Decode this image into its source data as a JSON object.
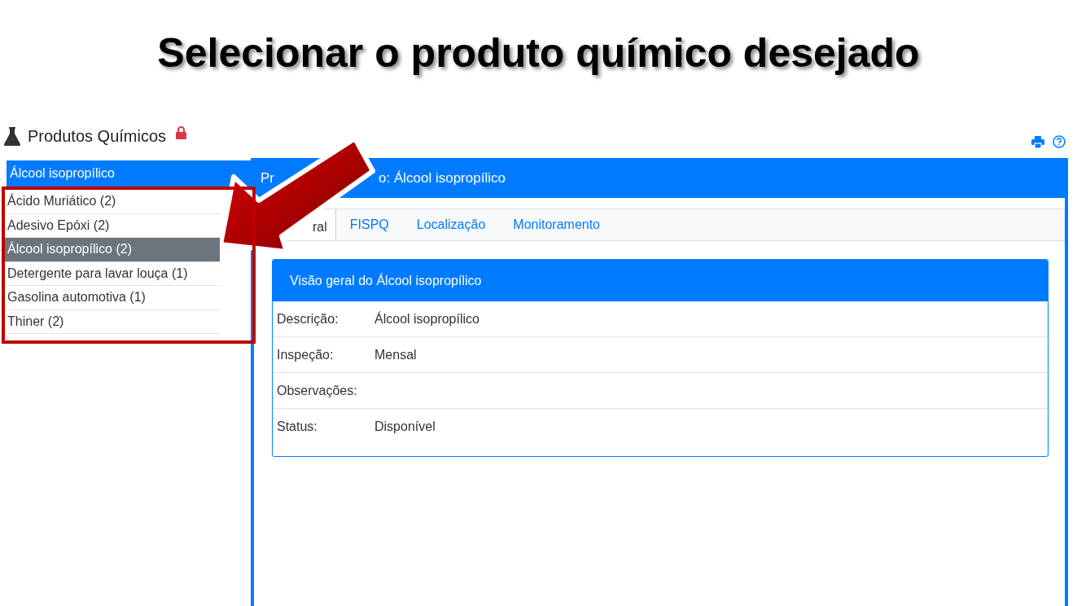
{
  "slide_title": "Selecionar o produto químico desejado",
  "page": {
    "title": "Produtos Químicos",
    "locked": true
  },
  "sidebar": {
    "header": "Álcool isopropílico",
    "items": [
      {
        "label": "Ácido Muriático (2)",
        "selected": false
      },
      {
        "label": "Adesivo Epóxi (2)",
        "selected": false
      },
      {
        "label": "Álcool isopropílico (2)",
        "selected": true
      },
      {
        "label": "Detergente para lavar louça (1)",
        "selected": false
      },
      {
        "label": "Gasolina automotiva (1)",
        "selected": false
      },
      {
        "label": "Thiner (2)",
        "selected": false
      }
    ]
  },
  "panel": {
    "header_visible_parts": [
      "Pr",
      "o: Álcool isopropílico"
    ],
    "tabs": [
      {
        "label": "ral",
        "selected": true
      },
      {
        "label": "FISPQ",
        "selected": false
      },
      {
        "label": "Localização",
        "selected": false
      },
      {
        "label": "Monitoramento",
        "selected": false
      }
    ],
    "card": {
      "title": "Visão geral do Álcool isopropílico",
      "rows": [
        {
          "label": "Descrição:",
          "value": "Álcool isopropílico"
        },
        {
          "label": "Inspeção:",
          "value": "Mensal"
        },
        {
          "label": "Observações:",
          "value": ""
        },
        {
          "label": "Status:",
          "value": "Disponível"
        }
      ]
    }
  }
}
